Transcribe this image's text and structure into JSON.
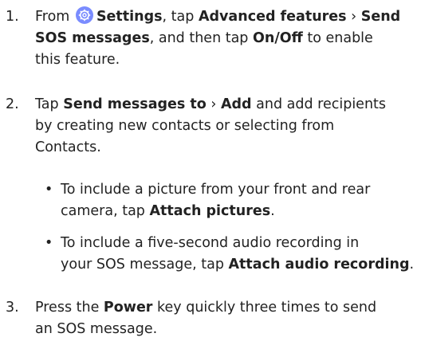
{
  "steps": [
    {
      "number": "1.",
      "parts": {
        "a": "From",
        "settings": "Settings",
        "b": ", tap",
        "advanced": "Advanced features",
        "sep": "›",
        "send_sos": "Send",
        "send_sos_2": "SOS messages",
        "c": ", and then tap",
        "onoff": "On/Off",
        "d": "to enable",
        "e": "this feature."
      }
    },
    {
      "number": "2.",
      "parts": {
        "a": "Tap",
        "send_to": "Send messages to",
        "sep": "›",
        "add": "Add",
        "b": "and add recipients",
        "c": "by creating new contacts or selecting from",
        "d": "Contacts."
      }
    },
    {
      "number": "3.",
      "parts": {
        "a": "Press the",
        "power": "Power",
        "b": "key quickly three times to send",
        "c": "an SOS message."
      }
    }
  ],
  "bullets": [
    {
      "symbol": "•",
      "line1": "To include a picture from your front and rear",
      "line2_a": "camera, tap",
      "attach": "Attach pictures",
      "end": "."
    },
    {
      "symbol": "•",
      "line1": "To include a five-second audio recording in",
      "line2_a": "your SOS message, tap",
      "attach": "Attach audio recording",
      "end": "."
    }
  ],
  "icons": {
    "settings": "gear-icon"
  },
  "colors": {
    "text": "#222222",
    "settings_icon": "#7a8cff"
  }
}
